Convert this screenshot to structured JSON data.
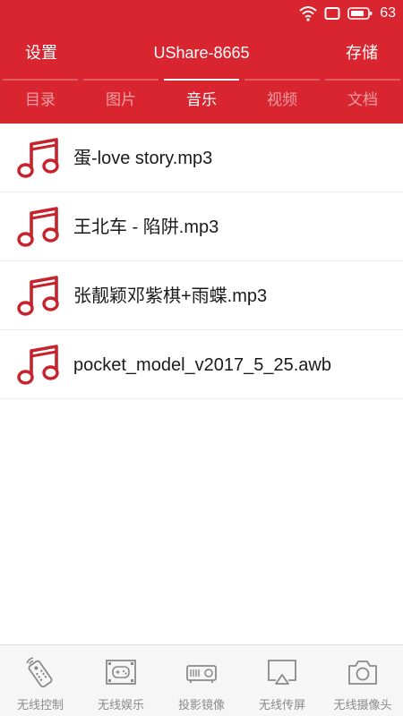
{
  "status_bar": {
    "battery_level": "63",
    "icons": [
      "wifi-icon",
      "screen-share-icon",
      "battery-icon"
    ]
  },
  "header": {
    "left_label": "设置",
    "title": "UShare-8665",
    "right_label": "存储"
  },
  "tabs": [
    {
      "label": "目录",
      "active": false
    },
    {
      "label": "图片",
      "active": false
    },
    {
      "label": "音乐",
      "active": true
    },
    {
      "label": "视频",
      "active": false
    },
    {
      "label": "文档",
      "active": false
    }
  ],
  "files": [
    {
      "name": "蛋-love story.mp3",
      "icon": "music-note-icon"
    },
    {
      "name": "王北车 - 陷阱.mp3",
      "icon": "music-note-icon"
    },
    {
      "name": "张靓颖邓紫棋+雨蝶.mp3",
      "icon": "music-note-icon"
    },
    {
      "name": "pocket_model_v2017_5_25.awb",
      "icon": "music-note-icon"
    }
  ],
  "bottom_nav": [
    {
      "label": "无线控制",
      "icon": "remote-control-icon"
    },
    {
      "label": "无线娱乐",
      "icon": "gamepad-film-icon"
    },
    {
      "label": "投影镜像",
      "icon": "projector-icon"
    },
    {
      "label": "无线传屏",
      "icon": "airplay-icon"
    },
    {
      "label": "无线摄像头",
      "icon": "camera-icon"
    }
  ],
  "colors": {
    "accent": "#d92530",
    "icon_red": "#c8232c",
    "nav_gray": "#8a8a8a"
  }
}
